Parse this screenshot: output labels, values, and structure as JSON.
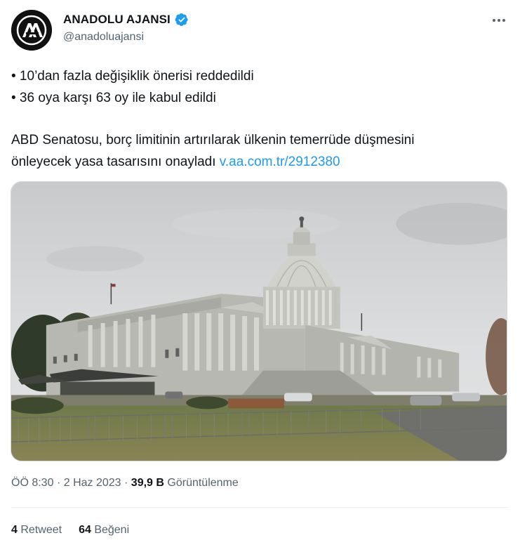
{
  "author": {
    "display_name": "ANADOLU AJANSI",
    "handle": "@anadoluajansi",
    "avatar_letters": "AA",
    "verified": true
  },
  "tweet": {
    "line1": "• 10’dan fazla değişiklik önerisi reddedildi",
    "line2": "• 36 oya karşı 63 oy ile kabul edildi",
    "para_line1": "ABD Senatosu, borç limitinin artırılarak ülkenin temerrüde düşmesini",
    "para_line2_text": "önleyecek yasa tasarısını onayladı ",
    "link": "v.aa.com.tr/2912380",
    "image_alt": "ABD Kongre binası (Capitol)"
  },
  "meta": {
    "time": "ÖÖ 8:30",
    "date": "2 Haz 2023",
    "views_count": "39,9 B",
    "views_label": "Görüntülenme",
    "sep": "·"
  },
  "stats": {
    "retweets_count": "4",
    "retweets_label": "Retweet",
    "likes_count": "64",
    "likes_label": "Beğeni"
  },
  "colors": {
    "text": "#0f1419",
    "secondary": "#536471",
    "link": "#1d9bf0",
    "verified": "#1d9bf0"
  }
}
